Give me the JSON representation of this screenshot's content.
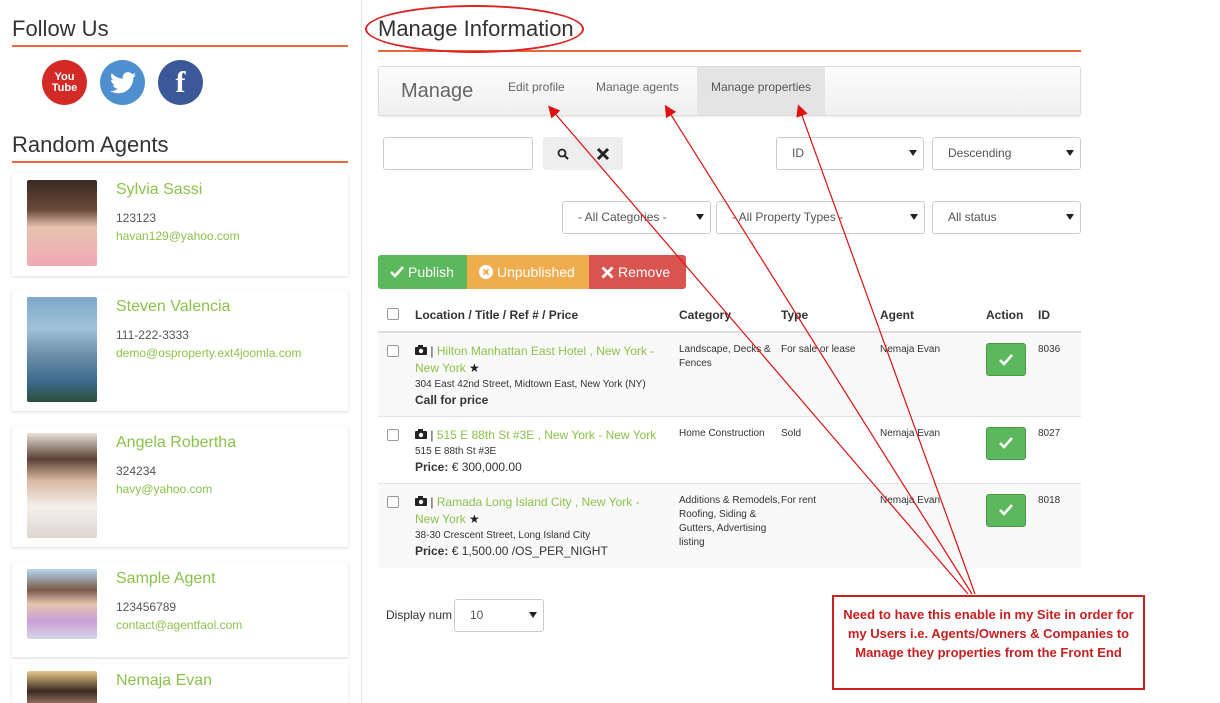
{
  "sidebar": {
    "follow_heading": "Follow Us",
    "agents_heading": "Random Agents",
    "social": [
      {
        "icon": "youtube-icon",
        "label_top": "You",
        "label_bottom": "Tube"
      },
      {
        "icon": "twitter-icon"
      },
      {
        "icon": "facebook-icon",
        "label": "f"
      }
    ],
    "agents": [
      {
        "name": "Sylvia Sassi",
        "phone": "123123",
        "email": "havan129@yahoo.com"
      },
      {
        "name": "Steven Valencia",
        "phone": "111-222-3333",
        "email": "demo@osproperty.ext4joomla.com"
      },
      {
        "name": "Angela Robertha",
        "phone": "324234",
        "email": "havy@yahoo.com"
      },
      {
        "name": "Sample Agent",
        "phone": "123456789",
        "email": "contact@agentfaol.com"
      },
      {
        "name": "Nemaja Evan"
      }
    ]
  },
  "main": {
    "title": "Manage Information",
    "tabs": {
      "brand": "Manage",
      "items": [
        "Edit profile",
        "Manage agents",
        "Manage properties"
      ],
      "active": "Manage properties"
    },
    "search": {
      "value": ""
    },
    "sort_by": "ID",
    "sort_order": "Descending",
    "filters": {
      "categories": "- All Categories -",
      "property_types": "- All Property Types -",
      "status": "All status"
    },
    "actions": {
      "publish": "Publish",
      "unpublished": "Unpublished",
      "remove": "Remove"
    },
    "table": {
      "headers": {
        "location": "Location / Title / Ref # / Price",
        "category": "Category",
        "type": "Type",
        "agent": "Agent",
        "action": "Action",
        "id": "ID"
      },
      "rows": [
        {
          "title_a": "Hilton Manhattan East Hotel , New York -",
          "title_b": "New York",
          "separator": "|",
          "featured": "★",
          "address": "304 East 42nd Street, Midtown East, New York (NY)",
          "price_label": "Call for price",
          "price_value": "",
          "category": "Landscape, Decks & Fences",
          "type": "For sale or lease",
          "agent": "Nemaja Evan",
          "id": "8036"
        },
        {
          "title_a": "515 E 88th St #3E , New York - New York",
          "title_b": "",
          "separator": "|",
          "featured": "",
          "address": "515 E 88th St #3E",
          "price_label": "Price:",
          "price_value": "€ 300,000.00",
          "category": "Home Construction",
          "type": "Sold",
          "agent": "Nemaja Evan",
          "id": "8027"
        },
        {
          "title_a": "Ramada Long Island City , New York -",
          "title_b": "New York",
          "separator": "|",
          "featured": "★",
          "address": "38-30 Crescent Street, Long Island City",
          "price_label": "Price:",
          "price_value": "€ 1,500.00 /OS_PER_NIGHT",
          "category": "Additions & Remodels, Roofing, Siding & Gutters, Advertising listing",
          "type": "For rent",
          "agent": "Nemaja Evan",
          "id": "8018"
        }
      ]
    },
    "display_num": {
      "label": "Display num",
      "value": "10"
    }
  },
  "annotation": {
    "text": "Need to have this enable in my Site in order for my Users i.e. Agents/Owners  & Companies  to Manage they properties from the Front End",
    "color": "#c62020"
  },
  "colors": {
    "accent": "#e6693e",
    "link": "#8bc34a",
    "publish": "#5cb85c",
    "unpublished": "#f0ad4e",
    "remove": "#d9534f"
  }
}
